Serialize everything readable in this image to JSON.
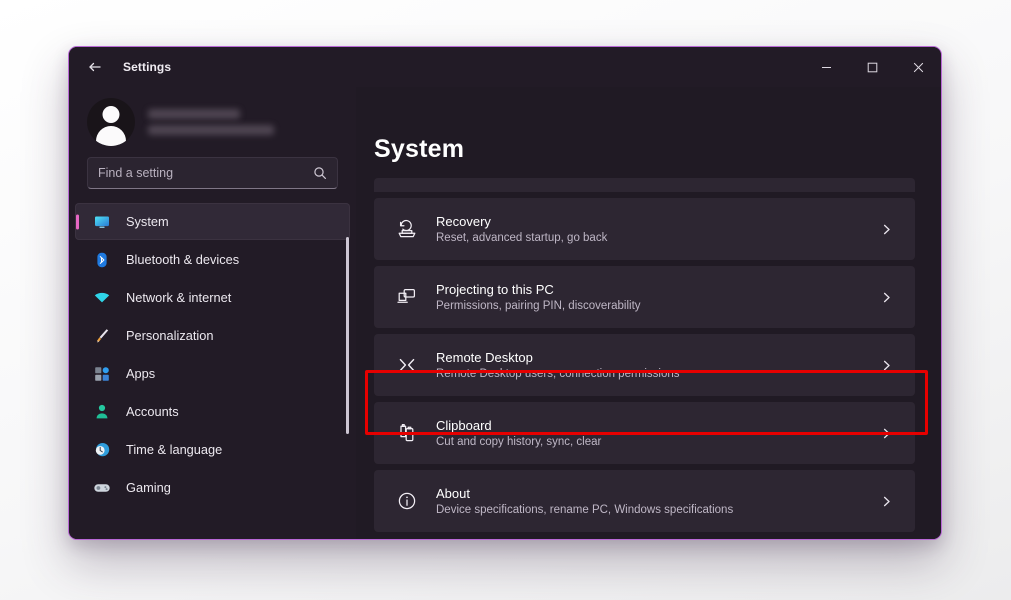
{
  "window": {
    "title": "Settings",
    "back_icon": "back-arrow-icon",
    "controls": {
      "minimize": "—",
      "maximize": "□",
      "close": "✕"
    }
  },
  "sidebar": {
    "profile": {
      "name": "",
      "email": "",
      "redacted": true
    },
    "search": {
      "placeholder": "Find a setting",
      "value": "",
      "icon": "search-icon"
    },
    "items": [
      {
        "label": "System",
        "icon": "monitor-icon",
        "selected": true
      },
      {
        "label": "Bluetooth & devices",
        "icon": "bluetooth-icon",
        "selected": false
      },
      {
        "label": "Network & internet",
        "icon": "wifi-icon",
        "selected": false
      },
      {
        "label": "Personalization",
        "icon": "paintbrush-icon",
        "selected": false
      },
      {
        "label": "Apps",
        "icon": "apps-grid-icon",
        "selected": false
      },
      {
        "label": "Accounts",
        "icon": "person-icon",
        "selected": false
      },
      {
        "label": "Time & language",
        "icon": "clock-icon",
        "selected": false
      },
      {
        "label": "Gaming",
        "icon": "gamepad-icon",
        "selected": false
      }
    ]
  },
  "main": {
    "title": "System",
    "cards": [
      {
        "title": "Recovery",
        "subtitle": "Reset, advanced startup, go back",
        "icon": "recovery-icon",
        "chevron": "chevron-right-icon"
      },
      {
        "title": "Projecting to this PC",
        "subtitle": "Permissions, pairing PIN, discoverability",
        "icon": "projecting-icon",
        "chevron": "chevron-right-icon"
      },
      {
        "title": "Remote Desktop",
        "subtitle": "Remote Desktop users, connection permissions",
        "icon": "remote-desktop-icon",
        "chevron": "chevron-right-icon"
      },
      {
        "title": "Clipboard",
        "subtitle": "Cut and copy history, sync, clear",
        "icon": "clipboard-icon",
        "chevron": "chevron-right-icon",
        "highlighted": true
      },
      {
        "title": "About",
        "subtitle": "Device specifications, rename PC, Windows specifications",
        "icon": "info-icon",
        "chevron": "chevron-right-icon"
      }
    ]
  },
  "colors": {
    "window_border": "#b969d6",
    "window_bg": "#201a24",
    "sidebar_bg": "#221b26",
    "card_bg": "#2d2632",
    "accent_pill": "#e667c4",
    "highlight_outline": "#e60000",
    "page_bg": "#ffffff"
  }
}
